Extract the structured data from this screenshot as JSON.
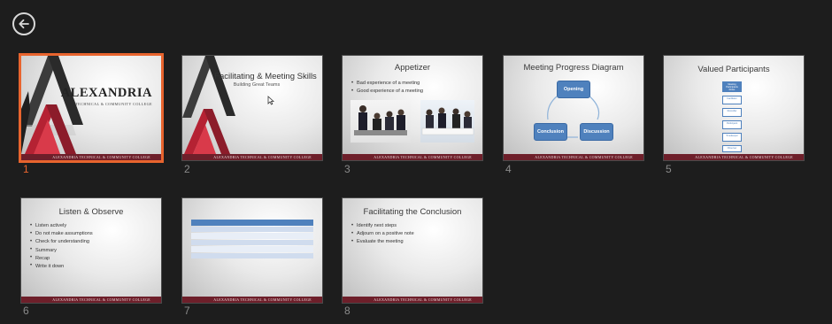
{
  "back_button": {
    "icon": "arrow-left-icon"
  },
  "footer_text": "ALEXANDRIA TECHNICAL & COMMUNITY COLLEGE",
  "accent_color": "#e8642e",
  "slides": [
    {
      "number": "1",
      "brand": "ALEXANDRIA",
      "brand_sub": "TECHNICAL & COMMUNITY COLLEGE",
      "selected": true
    },
    {
      "number": "2",
      "title": "Facilitating & Meeting Skills",
      "subtitle": "Building Great Teams"
    },
    {
      "number": "3",
      "title": "Appetizer",
      "bullets": [
        "Bad experience of a meeting",
        "Good experience of a meeting"
      ]
    },
    {
      "number": "4",
      "title": "Meeting Progress Diagram",
      "nodes": [
        "Opening",
        "Discussion",
        "Conclusion"
      ]
    },
    {
      "number": "5",
      "title": "Valued Participants",
      "boxes": [
        "Meeting Participants Roles",
        "Facilitator",
        "Recorder",
        "Participant",
        "Timekeeper",
        "Observer"
      ]
    },
    {
      "number": "6",
      "title": "Listen & Observe",
      "bullets": [
        "Listen actively",
        "Do not make assumptions",
        "Check for understanding",
        "Summary",
        "Recap",
        "Write it down"
      ]
    },
    {
      "number": "7"
    },
    {
      "number": "8",
      "title": "Facilitating the Conclusion",
      "bullets": [
        "Identify next steps",
        "Adjourn on a positive note",
        "Evaluate the meeting"
      ]
    }
  ]
}
